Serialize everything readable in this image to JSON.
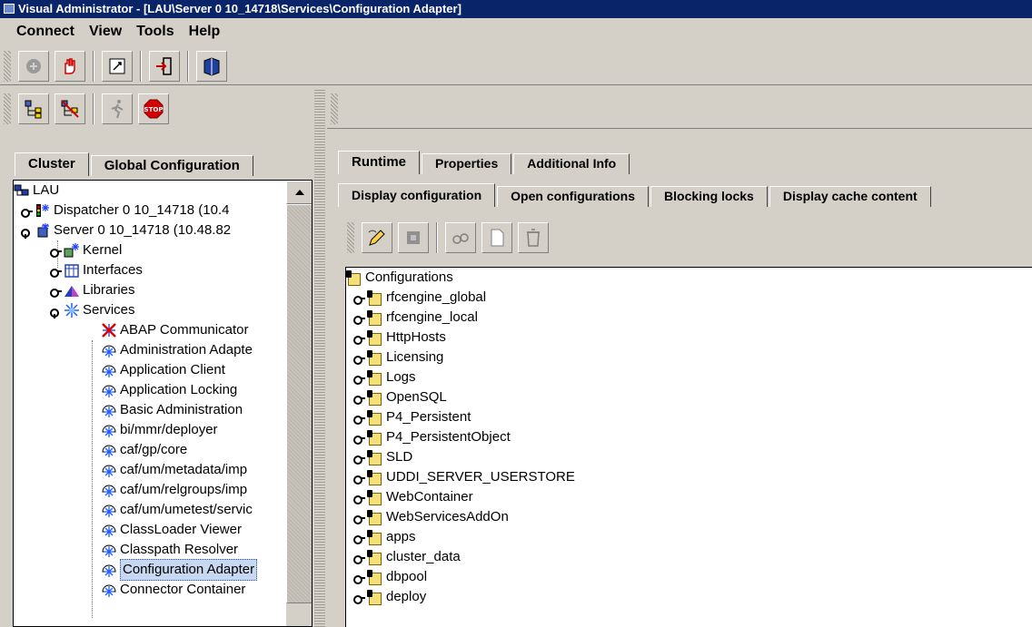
{
  "window": {
    "title": "Visual Administrator - [LAU\\Server 0 10_14718\\Services\\Configuration Adapter]"
  },
  "menu": [
    "Connect",
    "View",
    "Tools",
    "Help"
  ],
  "left_tabs": {
    "cluster": "Cluster",
    "global": "Global Configuration"
  },
  "tree": {
    "root": "LAU",
    "dispatcher": "Dispatcher 0 10_14718 (10.4",
    "server": "Server 0 10_14718 (10.48.82",
    "kernel": "Kernel",
    "interfaces": "Interfaces",
    "libraries": "Libraries",
    "services": "Services",
    "service_items": [
      "ABAP Communicator",
      "Administration Adapte",
      "Application Client",
      "Application Locking",
      "Basic Administration",
      "bi/mmr/deployer",
      "caf/gp/core",
      "caf/um/metadata/imp",
      "caf/um/relgroups/imp",
      "caf/um/umetest/servic",
      "ClassLoader Viewer",
      "Classpath Resolver",
      "Configuration Adapter",
      "Connector Container"
    ],
    "selected": "Configuration Adapter"
  },
  "right_tabs_top": {
    "runtime": "Runtime",
    "properties": "Properties",
    "additional": "Additional Info"
  },
  "right_tabs_sub": {
    "display_config": "Display configuration",
    "open_configs": "Open configurations",
    "blocking_locks": "Blocking locks",
    "display_cache": "Display cache content"
  },
  "configurations": {
    "root": "Configurations",
    "items": [
      "rfcengine_global",
      "rfcengine_local",
      "HttpHosts",
      "Licensing",
      "Logs",
      "OpenSQL",
      "P4_Persistent",
      "P4_PersistentObject",
      "SLD",
      "UDDI_SERVER_USERSTORE",
      "WebContainer",
      "WebServicesAddOn",
      "apps",
      "cluster_data",
      "dbpool",
      "deploy"
    ]
  },
  "colors": {
    "title_bar": "#0a246a",
    "window_bg": "#d4d0c8",
    "selection": "#c8d8f0"
  }
}
